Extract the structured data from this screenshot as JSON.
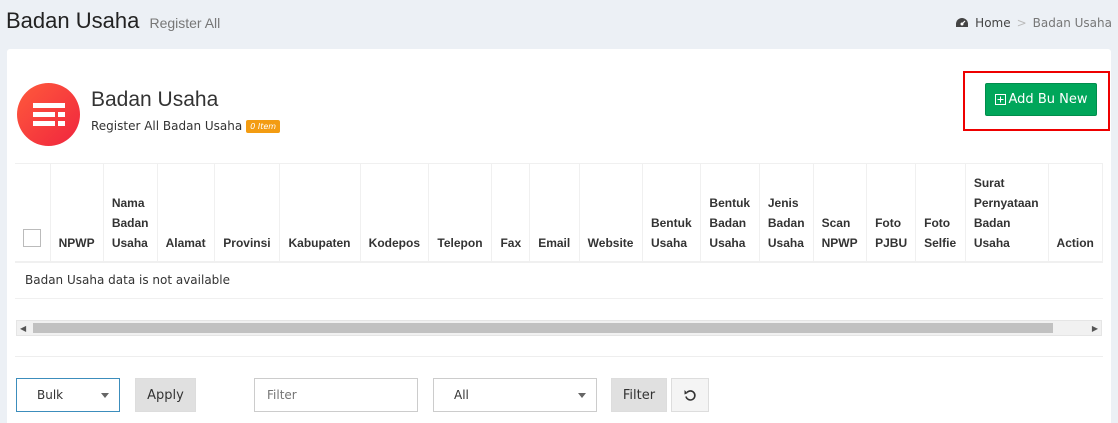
{
  "header": {
    "title": "Badan Usaha",
    "subtitle": "Register All",
    "breadcrumb": {
      "home": "Home",
      "current": "Badan Usaha"
    }
  },
  "box": {
    "title": "Badan Usaha",
    "subtitle": "Register All Badan Usaha",
    "badge": "0 Item",
    "add_button": "Add Bu New"
  },
  "table": {
    "columns": [
      "NPWP",
      "Nama\nBadan\nUsaha",
      "Alamat",
      "Provinsi",
      "Kabupaten",
      "Kodepos",
      "Telepon",
      "Fax",
      "Email",
      "Website",
      "Bentuk\nUsaha",
      "Bentuk\nBadan\nUsaha",
      "Jenis\nBadan\nUsaha",
      "Scan\nNPWP",
      "Foto\nPJBU",
      "Foto\nSelfie",
      "Surat\nPernyataan\nBadan\nUsaha",
      "Action"
    ],
    "empty_message": "Badan Usaha data is not available"
  },
  "footer": {
    "bulk_selected": "Bulk",
    "apply_label": "Apply",
    "filter_placeholder": "Filter",
    "filter_select_selected": "All",
    "filter_button": "Filter"
  },
  "colors": {
    "accent_green": "#00a65a",
    "badge_orange": "#f39c12",
    "highlight_red": "#e00000",
    "hero_gradient": "#f0253e"
  },
  "icons": {
    "breadcrumb": "dashboard-icon",
    "hero": "list-icon",
    "add": "plus-square-icon",
    "reset": "undo-icon"
  }
}
